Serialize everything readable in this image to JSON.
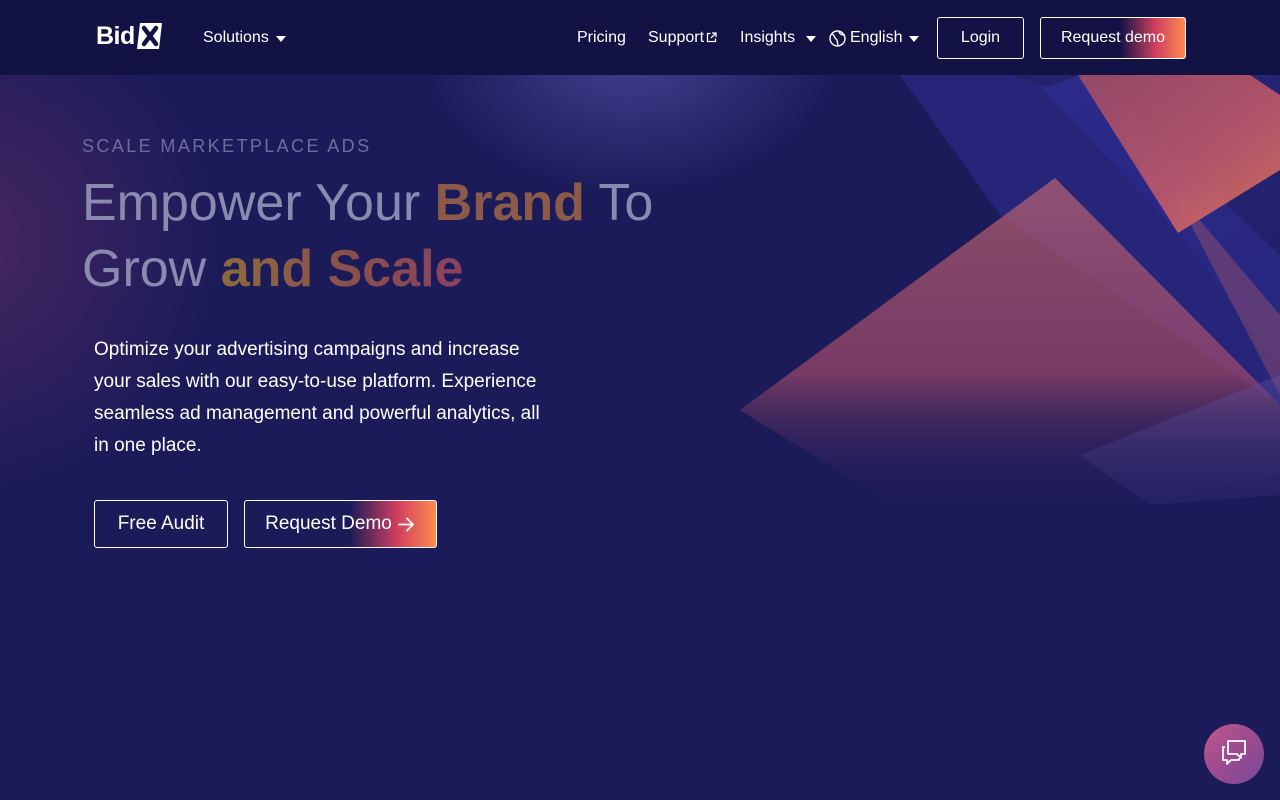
{
  "nav": {
    "logo_text": "Bid",
    "logo_mark": "X",
    "items": [
      {
        "label": "Solutions",
        "icon": "caret-down-icon"
      },
      {
        "label": "Pricing"
      },
      {
        "label": "Support",
        "icon": "external-link-icon"
      },
      {
        "label": "Insights",
        "icon": "caret-down-icon"
      },
      {
        "label": "English",
        "icon": "globe-icon"
      }
    ],
    "login_label": "Login",
    "request_demo_label": "Request demo"
  },
  "hero": {
    "eyebrow": "SCALE MARKETPLACE ADS",
    "headline_part1": "Empower Your ",
    "headline_brand": "Brand",
    "headline_part2": " To",
    "headline_part3": "Grow ",
    "headline_scale": "and Scale",
    "body": "Optimize your advertising campaigns and increase your sales with our easy-to-use platform. Experience seamless ad management and powerful analytics, all in one place.",
    "free_audit_label": "Free Audit",
    "request_demo_label": "Request Demo"
  },
  "chat": {
    "icon": "chat-bubbles-icon"
  },
  "colors": {
    "nav_bg": "#131245",
    "hero_bg": "#1c1b5a",
    "accent_pink": "#d2405f",
    "accent_orange": "#ff8a4c"
  }
}
